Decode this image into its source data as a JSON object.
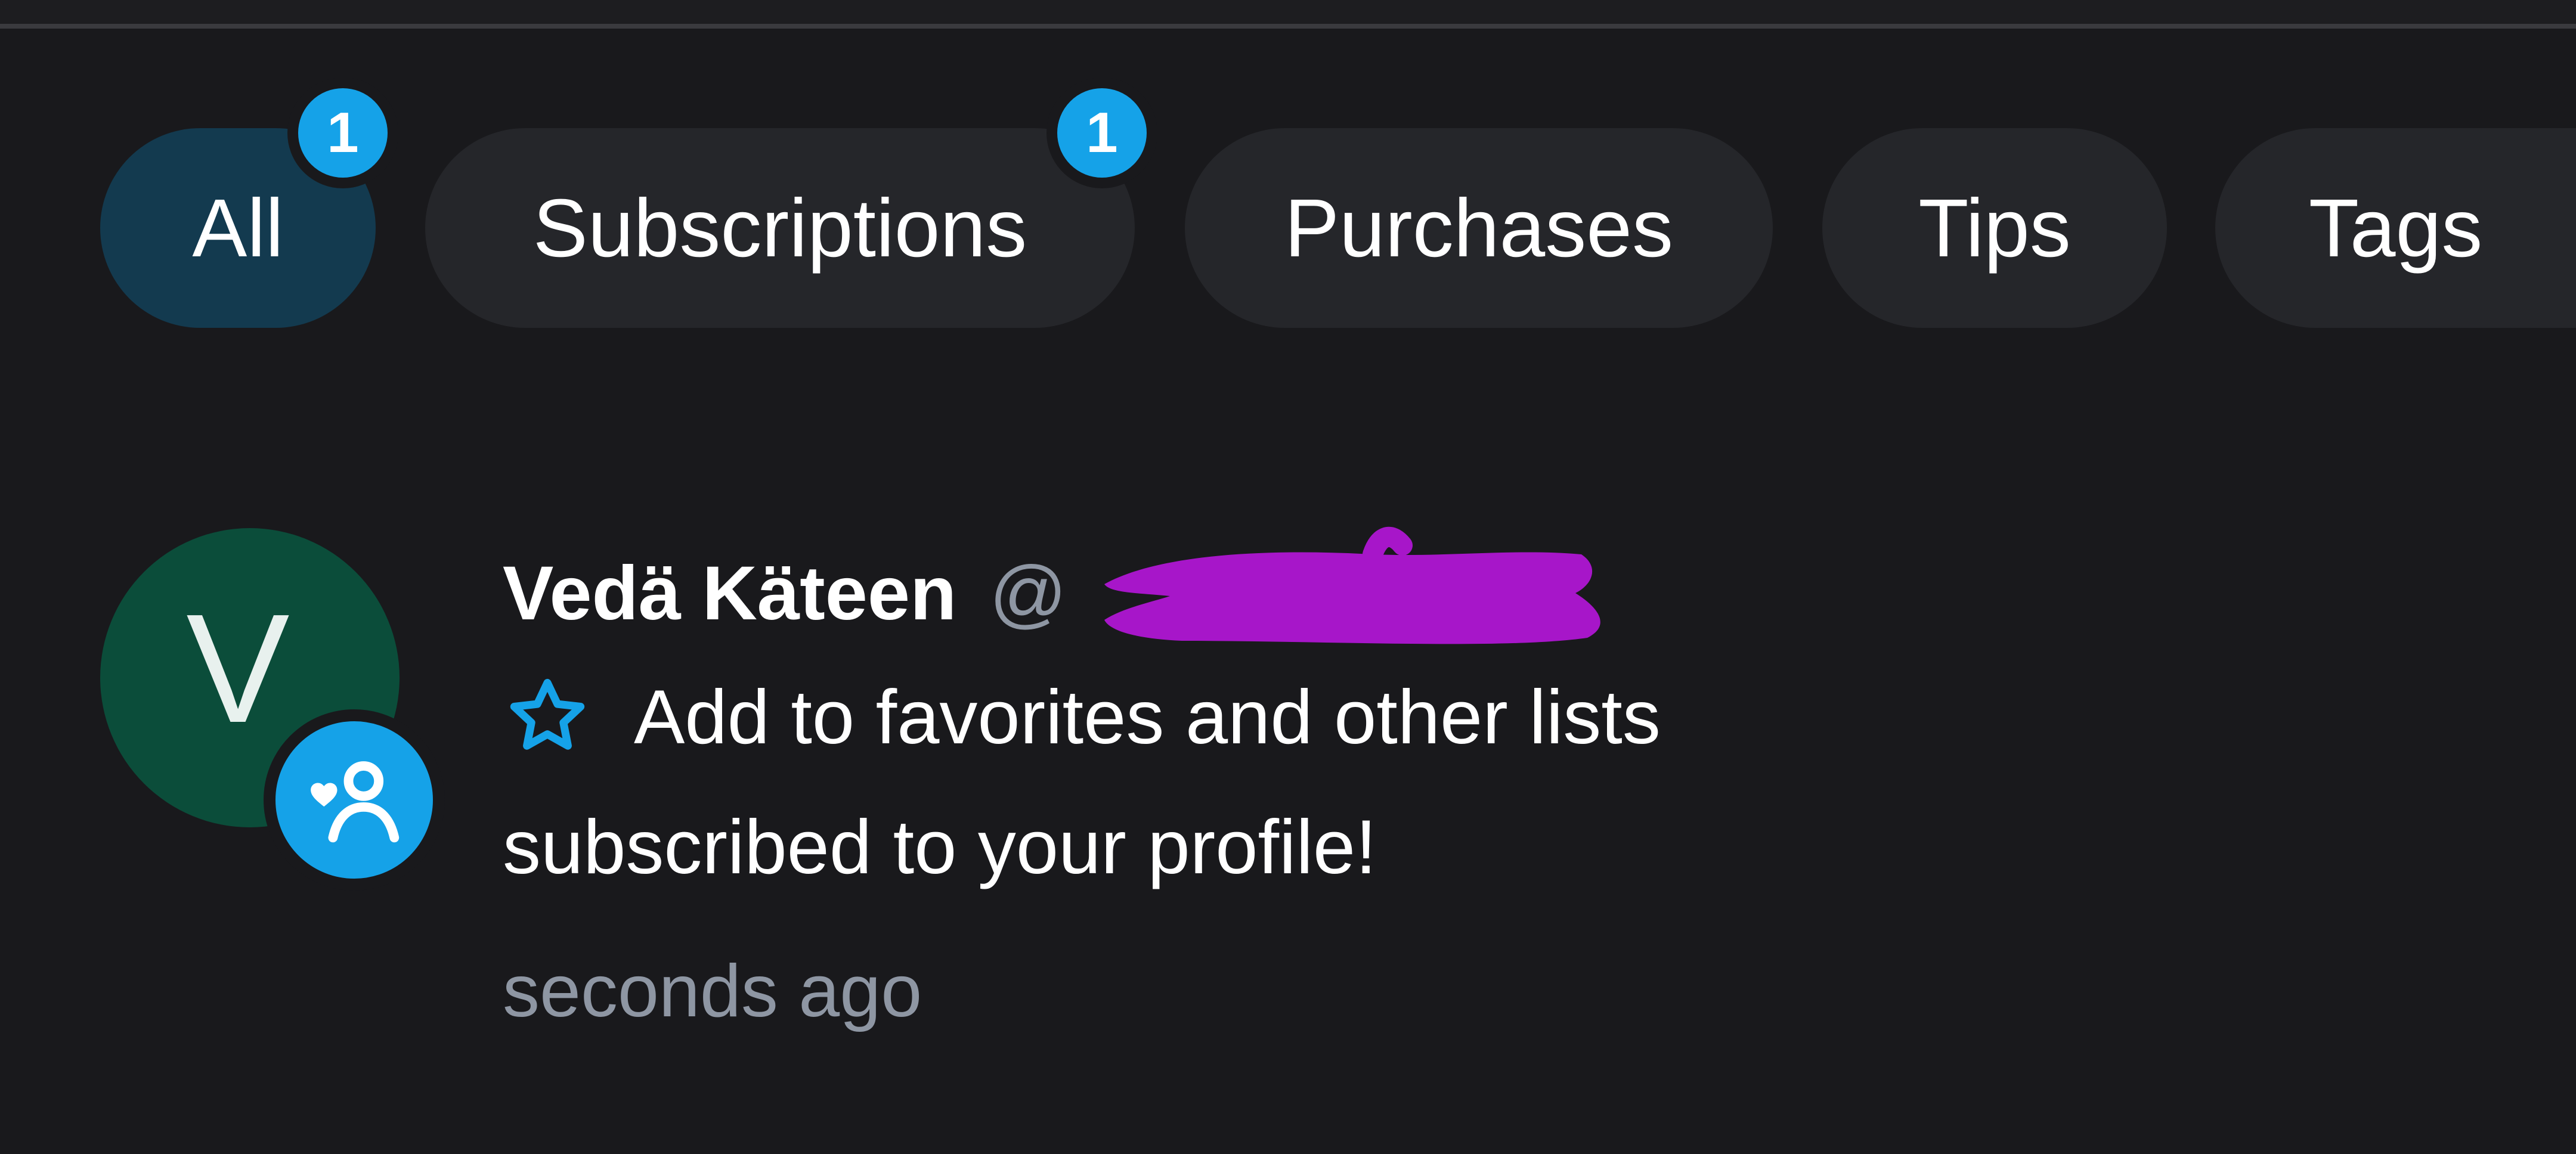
{
  "colors": {
    "background": "#19191c",
    "tab_background": "#25262a",
    "tab_active_background": "#133a4f",
    "accent": "#15a2e8",
    "avatar_background": "#0b4d3a",
    "muted_text": "#8e96a3",
    "redaction": "#a716c9"
  },
  "tabs": [
    {
      "label": "All",
      "badge": "1",
      "active": true
    },
    {
      "label": "Subscriptions",
      "badge": "1",
      "active": false
    },
    {
      "label": "Purchases",
      "active": false
    },
    {
      "label": "Tips",
      "active": false
    },
    {
      "label": "Tags",
      "active": false
    }
  ],
  "notification": {
    "avatar_letter": "V",
    "avatar_badge_icon": "subscriber-heart-icon",
    "user_name": "Vedä Käteen",
    "handle_prefix": "@",
    "favorite_icon": "star-outline-icon",
    "favorite_label": "Add to favorites and other lists",
    "message": "subscribed to your profile!",
    "time": "seconds ago"
  }
}
